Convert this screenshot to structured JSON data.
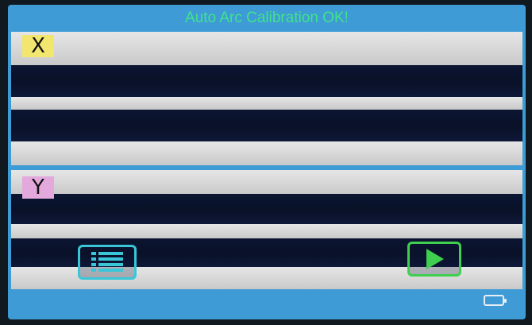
{
  "status": {
    "message": "Auto Arc Calibration OK!"
  },
  "views": {
    "x_label": "X",
    "y_label": "Y"
  },
  "buttons": {
    "menu_icon": "list-icon",
    "start_icon": "play-icon"
  },
  "status_bar": {
    "battery_icon": "battery-icon"
  },
  "colors": {
    "screen_background": "#3f9bd6",
    "title_text": "#3fe38a",
    "x_label_bg": "#f2e66f",
    "y_label_bg": "#e3a8dc",
    "menu_button": "#39c7d8",
    "start_button": "#3fcf4f"
  }
}
